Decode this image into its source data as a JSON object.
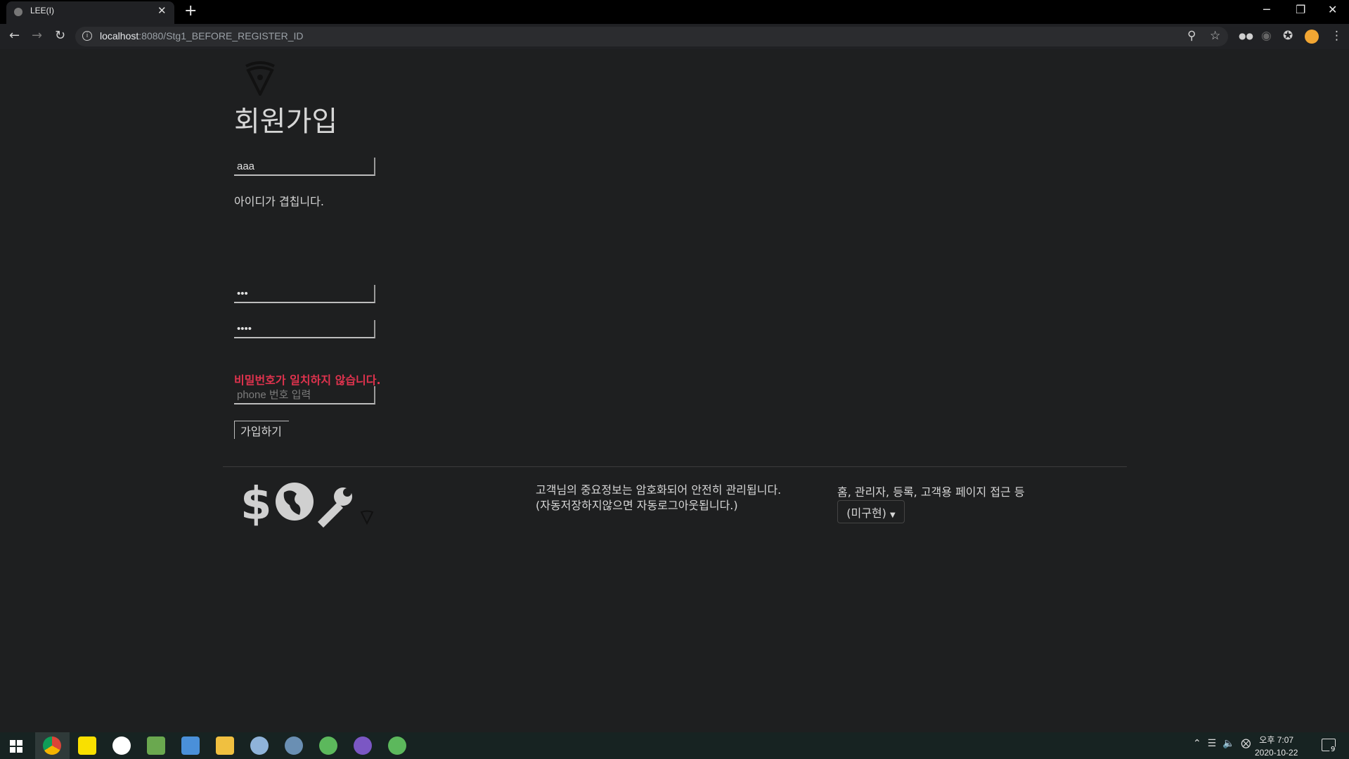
{
  "browser": {
    "tab_title": "LEE(I)",
    "url_host": "localhost",
    "url_path": ":8080/Stg1_BEFORE_REGISTER_ID",
    "new_tab": "+",
    "close_tab": "✕",
    "minimize": "─",
    "restore": "❐",
    "close_window": "✕"
  },
  "page": {
    "title": "회원가입",
    "id_value": "aaa",
    "id_message": "아이디가 겹칩니다.",
    "password_value": "aaa",
    "password_confirm_value": "aaaa",
    "password_message": "비밀번호가 일치하지 않습니다.",
    "phone_placeholder": "phone 번호 입력",
    "submit_label": "가입하기"
  },
  "footer": {
    "notice_line1": "고객님의 중요정보는 암호화되어 안전히 관리됩니다.",
    "notice_line2": "(자동저장하지않으면 자동로그아웃됩니다.)",
    "links_text": "홈, 관리자, 등록, 고객용 페이지 접근 등",
    "dropdown_label": "(미구현)"
  },
  "taskbar": {
    "time": "오후 7:07",
    "date": "2020-10-22",
    "notification_count": "9"
  },
  "colors": {
    "background": "#1e1f20",
    "error": "#e0334e",
    "text": "#d6d6d6"
  }
}
